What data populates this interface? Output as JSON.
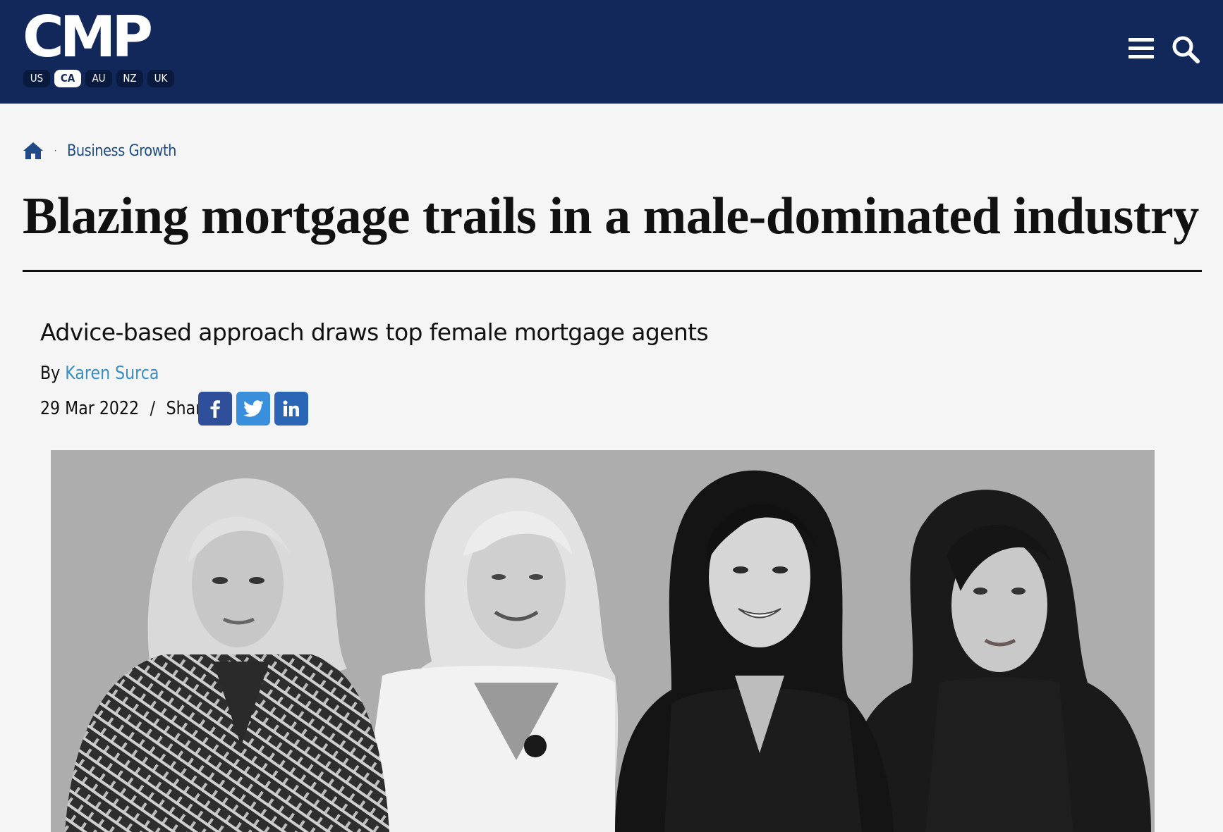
{
  "header": {
    "logo_text": "CMP",
    "regions": [
      {
        "label": "US",
        "active": false
      },
      {
        "label": "CA",
        "active": true
      },
      {
        "label": "AU",
        "active": false
      },
      {
        "label": "NZ",
        "active": false
      },
      {
        "label": "UK",
        "active": false
      }
    ],
    "menu_icon": "hamburger-menu-icon",
    "search_icon": "search-icon",
    "background_color": "#13285a"
  },
  "breadcrumb": {
    "home_icon": "home-icon",
    "separator": "·",
    "category": "Business Growth"
  },
  "article": {
    "title": "Blazing mortgage trails in a male-dominated industry",
    "subtitle": "Advice-based approach draws top female mortgage agents",
    "byline_prefix": "By",
    "author": "Karen Surca",
    "date": "29 Mar 2022",
    "meta_separator": "/",
    "share_label": "Share",
    "share_buttons": [
      {
        "network": "facebook",
        "icon": "facebook-icon",
        "color": "#2f4f9a"
      },
      {
        "network": "twitter",
        "icon": "twitter-icon",
        "color": "#3a8fdc"
      },
      {
        "network": "linkedin",
        "icon": "linkedin-icon",
        "color": "#2a66b5"
      }
    ],
    "hero_image": "black-and-white-photo-of-four-women"
  }
}
